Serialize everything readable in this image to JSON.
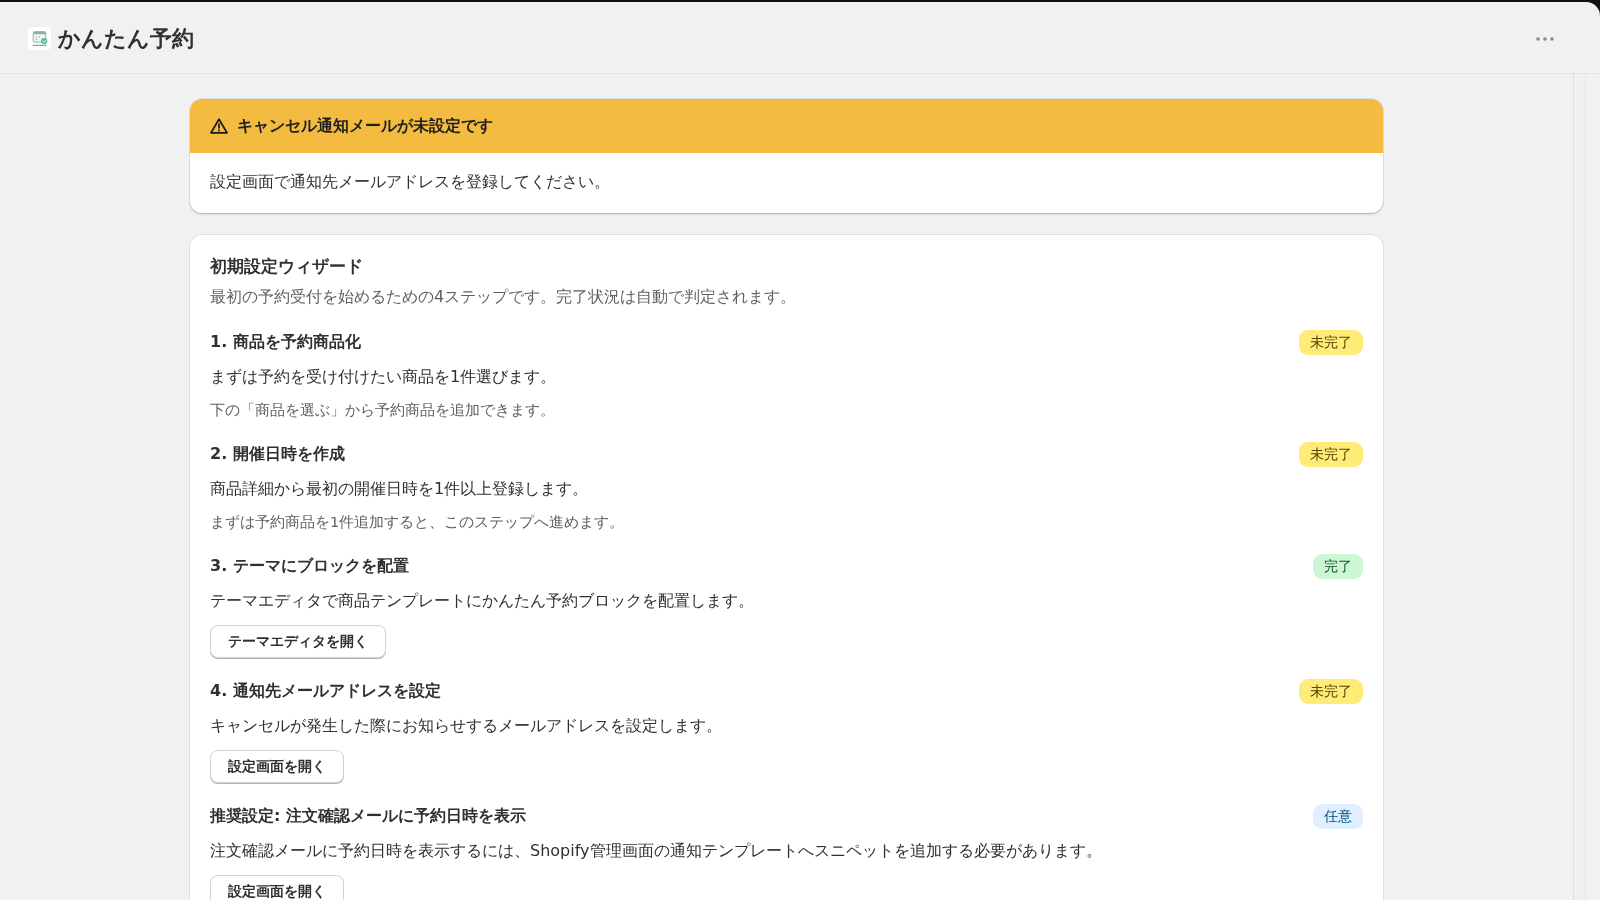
{
  "app": {
    "title": "かんたん予約"
  },
  "banner": {
    "kind": "warning",
    "title": "キャンセル通知メールが未設定です",
    "message": "設定画面で通知先メールアドレスを登録してください。"
  },
  "wizard": {
    "title": "初期設定ウィザード",
    "subtitle": "最初の予約受付を始めるための4ステップです。完了状況は自動で判定されます。",
    "steps": [
      {
        "title": "1. 商品を予約商品化",
        "status": {
          "kind": "incomplete",
          "label": "未完了"
        },
        "description": "まずは予約を受け付けたい商品を1件選びます。",
        "note": "下の「商品を選ぶ」から予約商品を追加できます。"
      },
      {
        "title": "2. 開催日時を作成",
        "status": {
          "kind": "incomplete",
          "label": "未完了"
        },
        "description": "商品詳細から最初の開催日時を1件以上登録します。",
        "note": "まずは予約商品を1件追加すると、このステップへ進めます。"
      },
      {
        "title": "3. テーマにブロックを配置",
        "status": {
          "kind": "complete",
          "label": "完了"
        },
        "description": "テーマエディタで商品テンプレートにかんたん予約ブロックを配置します。",
        "button": "テーマエディタを開く"
      },
      {
        "title": "4. 通知先メールアドレスを設定",
        "status": {
          "kind": "incomplete",
          "label": "未完了"
        },
        "description": "キャンセルが発生した際にお知らせするメールアドレスを設定します。",
        "button": "設定画面を開く"
      },
      {
        "title": "推奨設定: 注文確認メールに予約日時を表示",
        "status": {
          "kind": "optional",
          "label": "任意"
        },
        "description": "注文確認メールに予約日時を表示するには、Shopify管理画面の通知テンプレートへスニペットを追加する必要があります。",
        "button": "設定画面を開く"
      }
    ]
  }
}
